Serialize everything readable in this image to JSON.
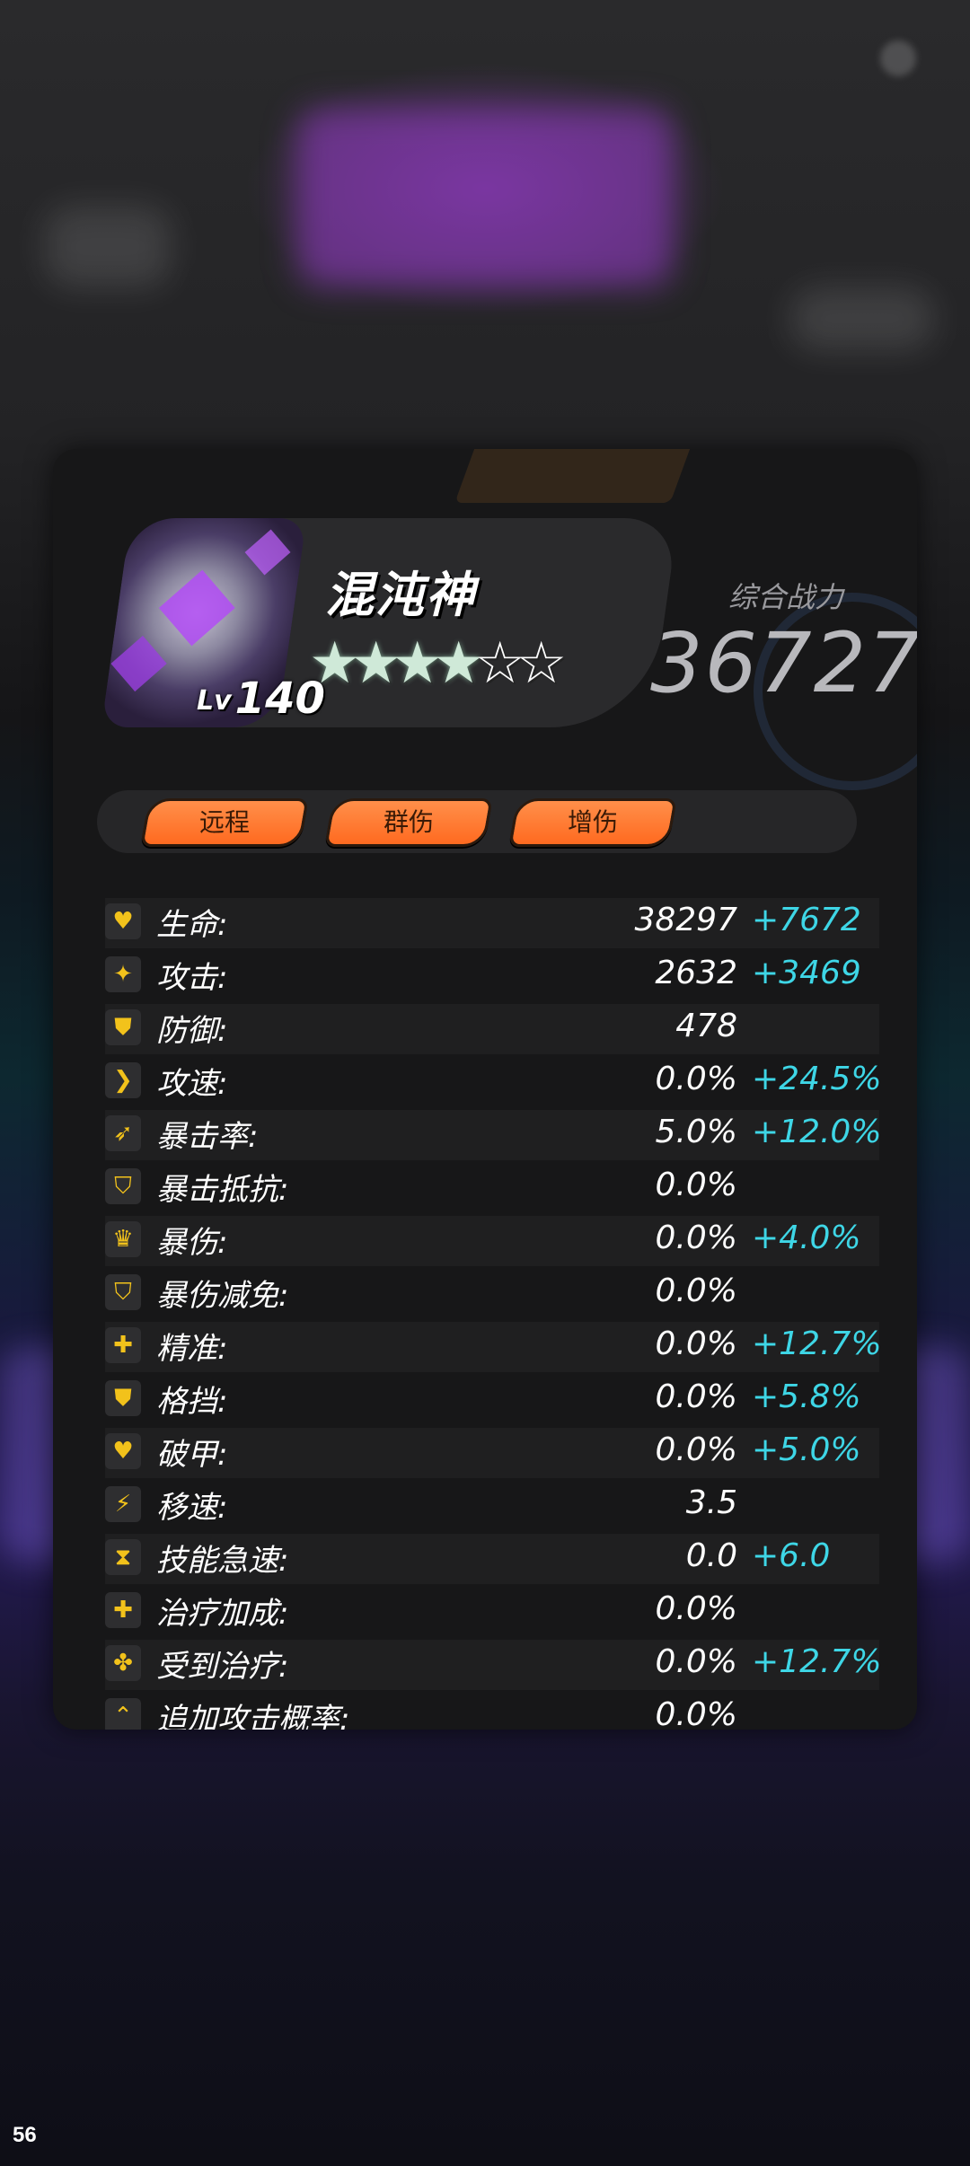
{
  "hero": {
    "name": "混沌神",
    "level_prefix": "Lv",
    "level": "140",
    "stars_filled": 4,
    "stars_total": 6
  },
  "power": {
    "label": "综合战力",
    "value": "36727"
  },
  "tags": [
    "远程",
    "群伤",
    "增伤"
  ],
  "stats": [
    {
      "icon": "heart-icon",
      "glyph": "♥",
      "label": "生命:",
      "base": "38297",
      "bonus": "+7672"
    },
    {
      "icon": "sparkle-icon",
      "glyph": "✦",
      "label": "攻击:",
      "base": "2632",
      "bonus": "+3469"
    },
    {
      "icon": "shield-icon",
      "glyph": "⛊",
      "label": "防御:",
      "base": "478",
      "bonus": ""
    },
    {
      "icon": "chevron-right-icon",
      "glyph": "❯",
      "label": "攻速:",
      "base": "0.0%",
      "bonus": "+24.5%"
    },
    {
      "icon": "feather-icon",
      "glyph": "➶",
      "label": "暴击率:",
      "base": "5.0%",
      "bonus": "+12.0%"
    },
    {
      "icon": "shield-outline-icon",
      "glyph": "⛉",
      "label": "暴击抵抗:",
      "base": "0.0%",
      "bonus": ""
    },
    {
      "icon": "crown-icon",
      "glyph": "♛",
      "label": "暴伤:",
      "base": "0.0%",
      "bonus": "+4.0%"
    },
    {
      "icon": "half-shield-icon",
      "glyph": "⛉",
      "label": "暴伤减免:",
      "base": "0.0%",
      "bonus": ""
    },
    {
      "icon": "crosshair-icon",
      "glyph": "✚",
      "label": "精准:",
      "base": "0.0%",
      "bonus": "+12.7%"
    },
    {
      "icon": "block-shield-icon",
      "glyph": "⛊",
      "label": "格挡:",
      "base": "0.0%",
      "bonus": "+5.8%"
    },
    {
      "icon": "armor-break-icon",
      "glyph": "♥",
      "label": "破甲:",
      "base": "0.0%",
      "bonus": "+5.0%"
    },
    {
      "icon": "lightning-icon",
      "glyph": "⚡",
      "label": "移速:",
      "base": "3.5",
      "bonus": ""
    },
    {
      "icon": "hourglass-icon",
      "glyph": "⧗",
      "label": "技能急速:",
      "base": "0.0",
      "bonus": "+6.0"
    },
    {
      "icon": "plus-icon",
      "glyph": "✚",
      "label": "治疗加成:",
      "base": "0.0%",
      "bonus": ""
    },
    {
      "icon": "clover-icon",
      "glyph": "✤",
      "label": "受到治疗:",
      "base": "0.0%",
      "bonus": "+12.7%"
    },
    {
      "icon": "up-arrow-icon",
      "glyph": "⌃",
      "label": "追加攻击概率:",
      "base": "0.0%",
      "bonus": ""
    }
  ],
  "footer": {
    "corner_number": "56"
  }
}
